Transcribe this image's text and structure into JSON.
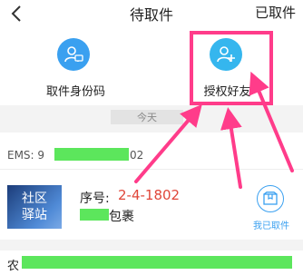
{
  "header": {
    "title": "待取件",
    "right_action": "已取件",
    "back_icon": "chevron-left-icon"
  },
  "actions": [
    {
      "label": "取件身份码",
      "icon": "user-id-card-icon",
      "color": "#3aa0f0"
    },
    {
      "label": "授权好友",
      "icon": "user-add-icon",
      "color": "#35b6ee"
    }
  ],
  "date_separator": "今天",
  "parcel": {
    "ems_prefix": "EMS:  9",
    "ems_suffix": "02",
    "station_line1": "社区",
    "station_line2": "驿站",
    "seq_label": "序号:",
    "seq_value": "2-4-1802",
    "package_label": "包裹",
    "picked_label": "我已取件",
    "picked_icon": "package-box-icon"
  },
  "bottom": {
    "prefix": "农"
  },
  "colors": {
    "accent_blue": "#3aa0f0",
    "highlight_pink": "#ff3c8a",
    "seq_red": "#e0473a",
    "mask_green": "#5ce65c"
  }
}
